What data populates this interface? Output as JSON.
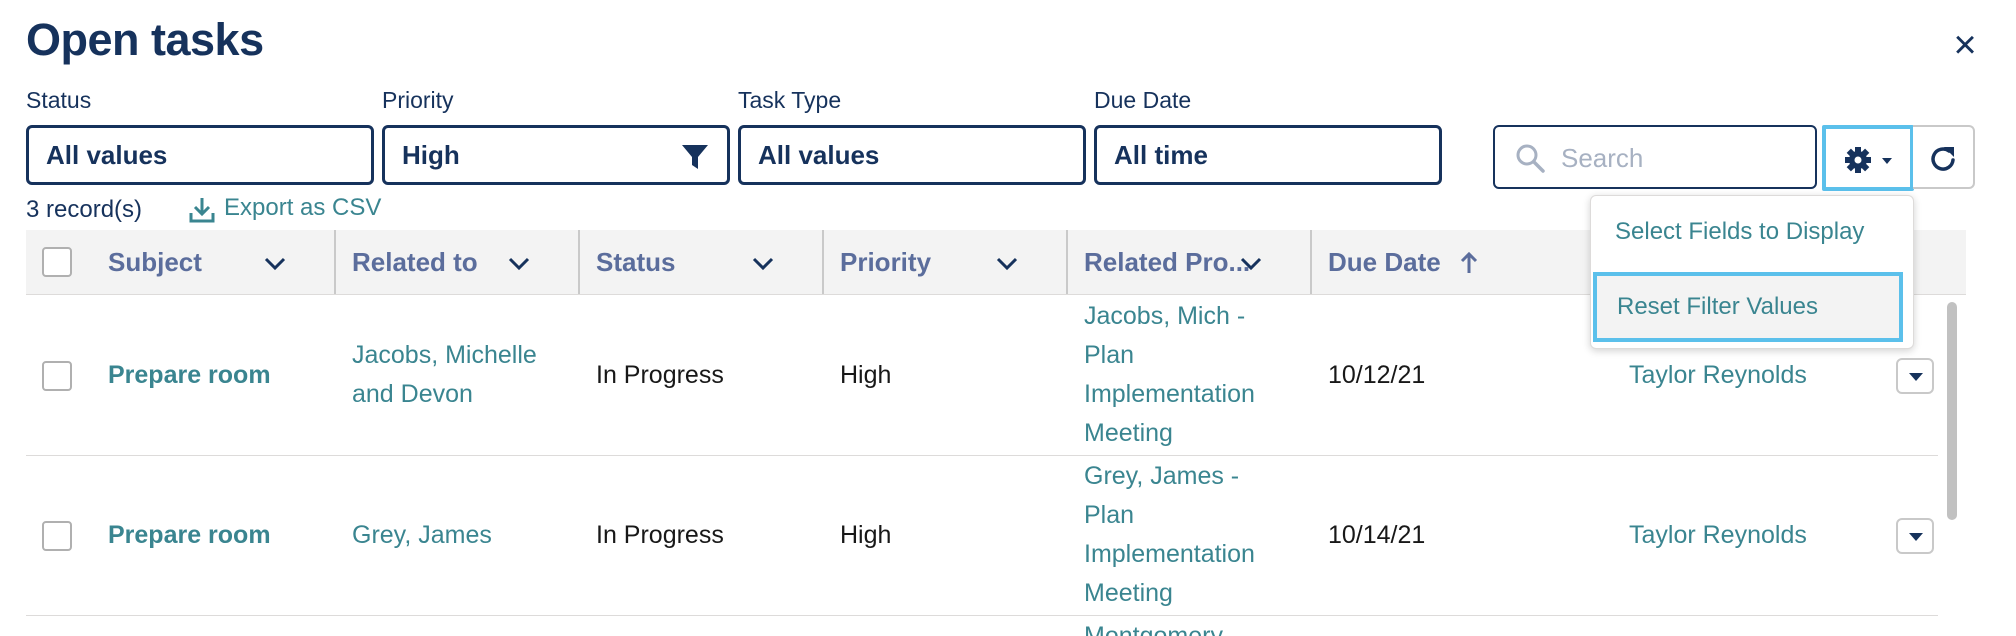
{
  "header": {
    "title": "Open tasks",
    "close_label": "×"
  },
  "filters": [
    {
      "label": "Status",
      "value": "All values"
    },
    {
      "label": "Priority",
      "value": "High"
    },
    {
      "label": "Task Type",
      "value": "All values"
    },
    {
      "label": "Due Date",
      "value": "All time"
    }
  ],
  "search": {
    "placeholder": "Search",
    "value": ""
  },
  "summary": {
    "records": "3 record(s)",
    "export_label": "Export as CSV"
  },
  "table": {
    "columns": [
      "Subject",
      "Related to",
      "Status",
      "Priority",
      "Related Pro...",
      "Due Date"
    ],
    "rows": [
      {
        "subject": "Prepare room",
        "related_to": [
          "Jacobs, Michelle",
          "and Devon"
        ],
        "status": "In Progress",
        "priority": "High",
        "related_pro": [
          "Jacobs, Mich -",
          "Plan",
          "Implementation",
          "Meeting"
        ],
        "due_date": "10/12/21",
        "assigned": "Taylor Reynolds"
      },
      {
        "subject": "Prepare room",
        "related_to": [
          "Grey, James"
        ],
        "status": "In Progress",
        "priority": "High",
        "related_pro": [
          "Grey, James -",
          "Plan",
          "Implementation",
          "Meeting"
        ],
        "due_date": "10/14/21",
        "assigned": "Taylor Reynolds"
      },
      {
        "related_pro": [
          "Montgomery"
        ]
      }
    ]
  },
  "settings_menu": {
    "items": [
      "Select Fields to Display",
      "Reset Filter Values"
    ]
  },
  "colors": {
    "navy": "#16325c",
    "teal_link": "#3a8590",
    "focus_ring": "#5bc0eb",
    "header_bg": "#f3f3f3"
  },
  "icons": {
    "close": "close-icon",
    "funnel": "filter-icon",
    "search": "search-icon",
    "gear": "gear-icon",
    "refresh": "refresh-icon",
    "export": "download-icon",
    "sort": "arrow-up-icon",
    "chevron": "chevron-down-icon"
  }
}
